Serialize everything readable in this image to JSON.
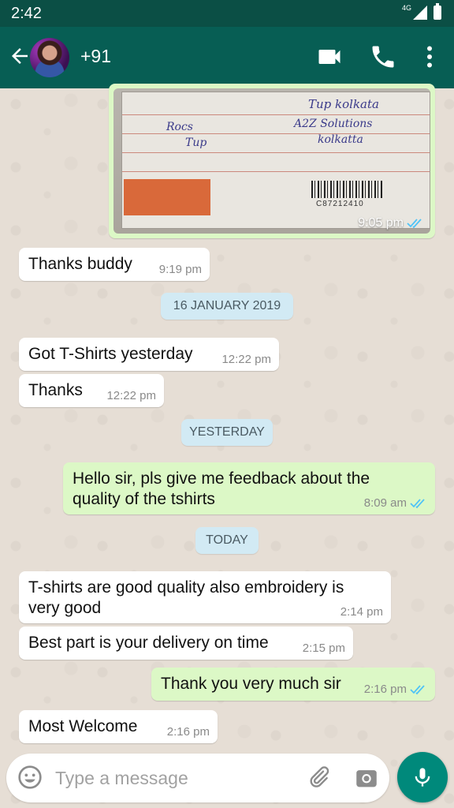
{
  "status_bar": {
    "time": "2:42",
    "network": "4G"
  },
  "header": {
    "contact": "+91"
  },
  "image_message": {
    "time": "9:05 pm",
    "receipt_number": "C87212410",
    "handwriting": [
      "Tup kolkata",
      "A2Z Solutions",
      "kolkatta",
      "Tup",
      "Rocs"
    ]
  },
  "messages": [
    {
      "dir": "in",
      "text": "Thanks buddy",
      "time": "9:19 pm"
    },
    {
      "date": "16 JANUARY 2019"
    },
    {
      "dir": "in",
      "text": "Got T-Shirts yesterday",
      "time": "12:22 pm"
    },
    {
      "dir": "in",
      "text": "Thanks",
      "time": "12:22 pm"
    },
    {
      "date": "YESTERDAY"
    },
    {
      "dir": "out",
      "text": "Hello sir, pls give me feedback about the quality of the tshirts",
      "time": "8:09 am"
    },
    {
      "date": "TODAY"
    },
    {
      "dir": "in",
      "text": "T-shirts are good quality also embroidery is very good",
      "time": "2:14 pm"
    },
    {
      "dir": "in",
      "text": "Best part is your delivery on time",
      "time": "2:15 pm"
    },
    {
      "dir": "out",
      "text": "Thank you very much sir",
      "time": "2:16 pm"
    },
    {
      "dir": "in",
      "text": "Most Welcome",
      "time": "2:16 pm"
    }
  ],
  "input": {
    "placeholder": "Type a message"
  },
  "colors": {
    "header": "#075e54",
    "statusbar": "#0b4f45",
    "outgoing": "#dcf8c6",
    "incoming": "#ffffff",
    "date_chip": "#d2eaf4",
    "read_ticks": "#4fc3f7",
    "mic": "#00897b"
  },
  "icons": [
    "back-arrow-icon",
    "video-call-icon",
    "phone-icon",
    "more-vert-icon",
    "emoji-icon",
    "attach-icon",
    "camera-icon",
    "mic-icon",
    "double-tick-icon"
  ]
}
